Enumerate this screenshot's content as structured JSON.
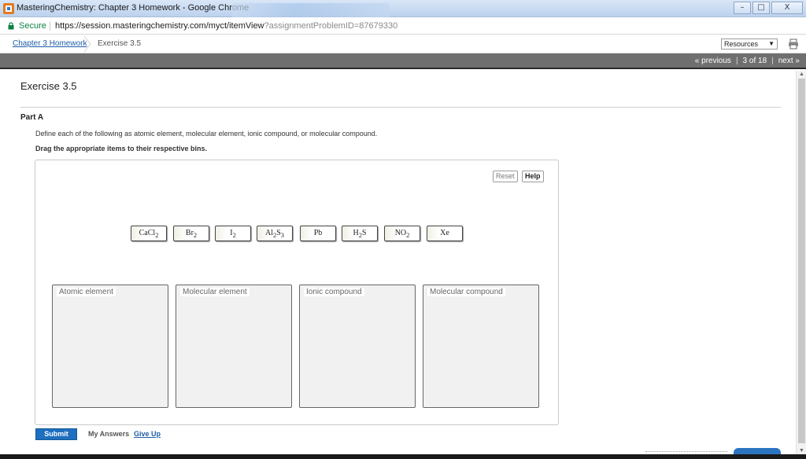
{
  "window": {
    "title": "MasteringChemistry: Chapter 3 Homework - Google Chrome",
    "buttons": [
      "–",
      "□",
      "X"
    ]
  },
  "address": {
    "secure_label": "Secure",
    "url_base": "https://session.masteringchemistry.com/myct/itemView",
    "url_query": "?assignmentProblemID=87679330"
  },
  "breadcrumb": {
    "parent": "Chapter 3 Homework",
    "current": "Exercise 3.5"
  },
  "toolbar": {
    "resources": "Resources"
  },
  "nav": {
    "previous": "« previous",
    "position": "3 of 18",
    "next": "next »"
  },
  "main": {
    "title": "Exercise 3.5",
    "part": "Part A",
    "question": "Define each of the following as atomic element, molecular element, ionic compound, or molecular compound.",
    "instruction": "Drag the appropriate items to their respective bins.",
    "reset": "Reset",
    "help": "Help",
    "items": [
      {
        "base": "CaCl",
        "sub": "2",
        "rest": ""
      },
      {
        "base": "Br",
        "sub": "2",
        "rest": ""
      },
      {
        "base": "I",
        "sub": "2",
        "rest": ""
      },
      {
        "base": "Al",
        "sub": "2",
        "rest": "S",
        "sub2": "3"
      },
      {
        "base": "Pb",
        "sub": "",
        "rest": ""
      },
      {
        "base": "H",
        "sub": "2",
        "rest": "S"
      },
      {
        "base": "NO",
        "sub": "2",
        "rest": ""
      },
      {
        "base": "Xe",
        "sub": "",
        "rest": ""
      }
    ],
    "bins": [
      "Atomic element",
      "Molecular element",
      "Ionic compound",
      "Molecular compound"
    ],
    "submit": "Submit",
    "my_answers": "My Answers",
    "give_up": "Give Up"
  }
}
